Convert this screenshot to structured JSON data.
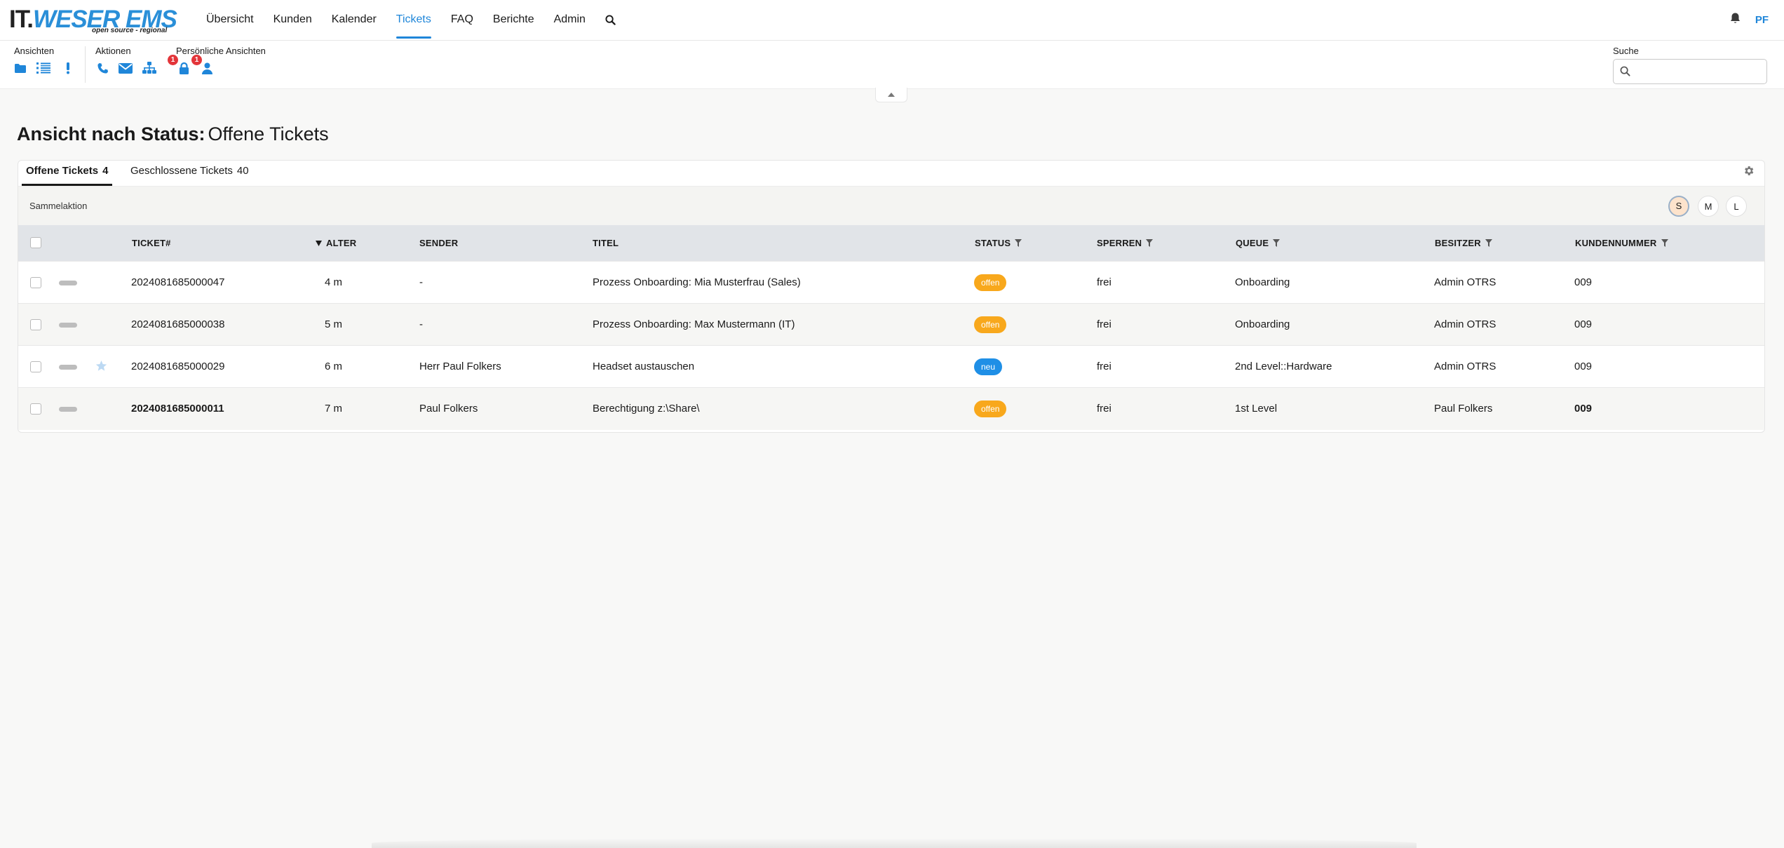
{
  "logo": {
    "main_prefix": "IT.",
    "main_brand": "WESER EMS",
    "subtitle": "open source - regional"
  },
  "nav": {
    "items": [
      {
        "label": "Übersicht"
      },
      {
        "label": "Kunden"
      },
      {
        "label": "Kalender"
      },
      {
        "label": "Tickets",
        "active": true
      },
      {
        "label": "FAQ"
      },
      {
        "label": "Berichte"
      },
      {
        "label": "Admin"
      }
    ],
    "search_icon": "search-icon"
  },
  "user": {
    "initials": "PF",
    "bell_icon": "bell-icon"
  },
  "toolbar": {
    "views_label": "Ansichten",
    "views_icons": [
      "folder-icon",
      "list-icon",
      "exclamation-icon"
    ],
    "actions_label": "Aktionen",
    "actions_icons": [
      "phone-icon",
      "envelope-icon",
      "sitemap-icon"
    ],
    "personal_label": "Persönliche Ansichten",
    "personal_icons": [
      "lock-icon",
      "user-icon"
    ],
    "lock_badge": "1",
    "user_badge": "1",
    "search_label": "Suche",
    "search_value": ""
  },
  "page": {
    "title_strong": "Ansicht nach Status:",
    "title_normal": "Offene Tickets"
  },
  "tabs": [
    {
      "label": "Offene Tickets",
      "count": "4",
      "active": true
    },
    {
      "label": "Geschlossene Tickets",
      "count": "40",
      "active": false
    }
  ],
  "bulk": {
    "label": "Sammelaktion",
    "sizes": [
      {
        "label": "S",
        "active": true
      },
      {
        "label": "M",
        "active": false
      },
      {
        "label": "L",
        "active": false
      }
    ]
  },
  "table": {
    "columns": {
      "ticket": "TICKET#",
      "age": "ALTER",
      "sender": "SENDER",
      "title": "TITEL",
      "status": "STATUS",
      "lock": "SPERREN",
      "queue": "QUEUE",
      "owner": "BESITZER",
      "customer": "KUNDENNUMMER"
    },
    "rows": [
      {
        "ticket": "2024081685000047",
        "age": "4 m",
        "sender": "-",
        "title": "Prozess Onboarding: Mia Musterfrau (Sales)",
        "status": "offen",
        "lock": "frei",
        "queue": "Onboarding",
        "owner": "Admin OTRS",
        "customer": "009",
        "starred": false,
        "unread": false
      },
      {
        "ticket": "2024081685000038",
        "age": "5 m",
        "sender": "-",
        "title": "Prozess Onboarding: Max Mustermann (IT)",
        "status": "offen",
        "lock": "frei",
        "queue": "Onboarding",
        "owner": "Admin OTRS",
        "customer": "009",
        "starred": false,
        "unread": false
      },
      {
        "ticket": "2024081685000029",
        "age": "6 m",
        "sender": "Herr Paul Folkers",
        "title": "Headset austauschen",
        "status": "neu",
        "lock": "frei",
        "queue": "2nd Level::Hardware",
        "owner": "Admin OTRS",
        "customer": "009",
        "starred": true,
        "unread": false
      },
      {
        "ticket": "2024081685000011",
        "age": "7 m",
        "sender": "Paul Folkers",
        "title": "Berechtigung z:\\Share\\",
        "status": "offen",
        "lock": "frei",
        "queue": "1st Level",
        "owner": "Paul Folkers",
        "customer": "009",
        "starred": false,
        "unread": true
      }
    ]
  },
  "colors": {
    "accent": "#1f86d9",
    "status_offen": "#f8a81c",
    "status_neu": "#1f8fe6",
    "badge": "#e3353a"
  }
}
